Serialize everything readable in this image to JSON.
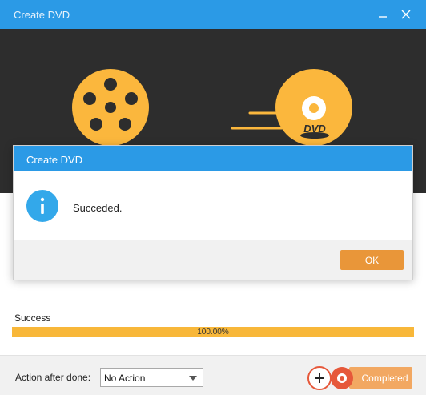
{
  "window": {
    "title": "Create DVD"
  },
  "controls": {
    "minimize": "minimize-icon",
    "close": "close-icon"
  },
  "banner": {
    "film_icon": "film-reel-icon",
    "disc_icon": "dvd-disc-icon",
    "disc_label": "DVD",
    "colors": {
      "background": "#2d2d2d",
      "icon": "#fbb73d"
    }
  },
  "dialog": {
    "title": "Create DVD",
    "icon": "info-icon",
    "message": "Succeded.",
    "ok_label": "OK"
  },
  "progress": {
    "label": "Success",
    "text": "100.00%",
    "value": 1.0
  },
  "footer": {
    "after_done_label": "Action after done:",
    "after_done_value": "No Action",
    "completed_label": "Completed"
  },
  "watermark": {
    "icon": "watermark-logo-icon"
  },
  "colors": {
    "accent": "#2b9ae6",
    "ok_button": "#e99639",
    "progress": "#f8b739"
  }
}
